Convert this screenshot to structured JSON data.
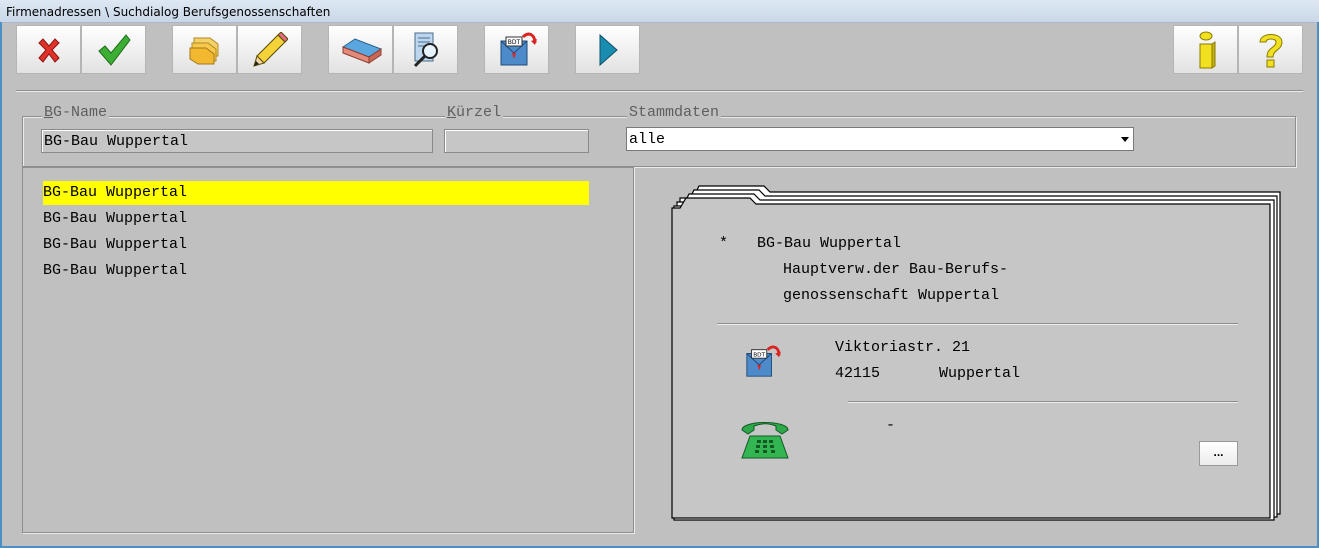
{
  "window": {
    "title": "Firmenadressen \\ Suchdialog Berufsgenossenschaften"
  },
  "toolbar": {
    "icons": [
      "close-icon",
      "check-icon",
      "folders-icon",
      "pencil-icon",
      "eraser-icon",
      "search-document-icon",
      "bdt-mail-icon",
      "play-icon",
      "info-icon",
      "help-icon"
    ]
  },
  "filters": {
    "bg_name_label_first": "B",
    "bg_name_label_rest": "G-Name",
    "bg_name_value": "BG-Bau Wuppertal",
    "kuerzel_label_first": "K",
    "kuerzel_label_rest": "ürzel",
    "kuerzel_value": "",
    "stammdaten_label": "Stammdaten",
    "stammdaten_value": "alle"
  },
  "results": [
    {
      "name": "BG-Bau Wuppertal",
      "selected": true
    },
    {
      "name": "BG-Bau Wuppertal",
      "selected": false
    },
    {
      "name": "BG-Bau Wuppertal",
      "selected": false
    },
    {
      "name": "BG-Bau Wuppertal",
      "selected": false
    }
  ],
  "detail": {
    "marker": "*",
    "name": "BG-Bau Wuppertal",
    "line2": "Hauptverw.der Bau-Berufs-",
    "line3": "genossenschaft Wuppertal",
    "street": "Viktoriastr. 21",
    "zip": "42115",
    "city": "Wuppertal",
    "phone": "-",
    "more_label": "..."
  },
  "colors": {
    "selection": "#ffff00",
    "background": "#c0c0c0"
  }
}
